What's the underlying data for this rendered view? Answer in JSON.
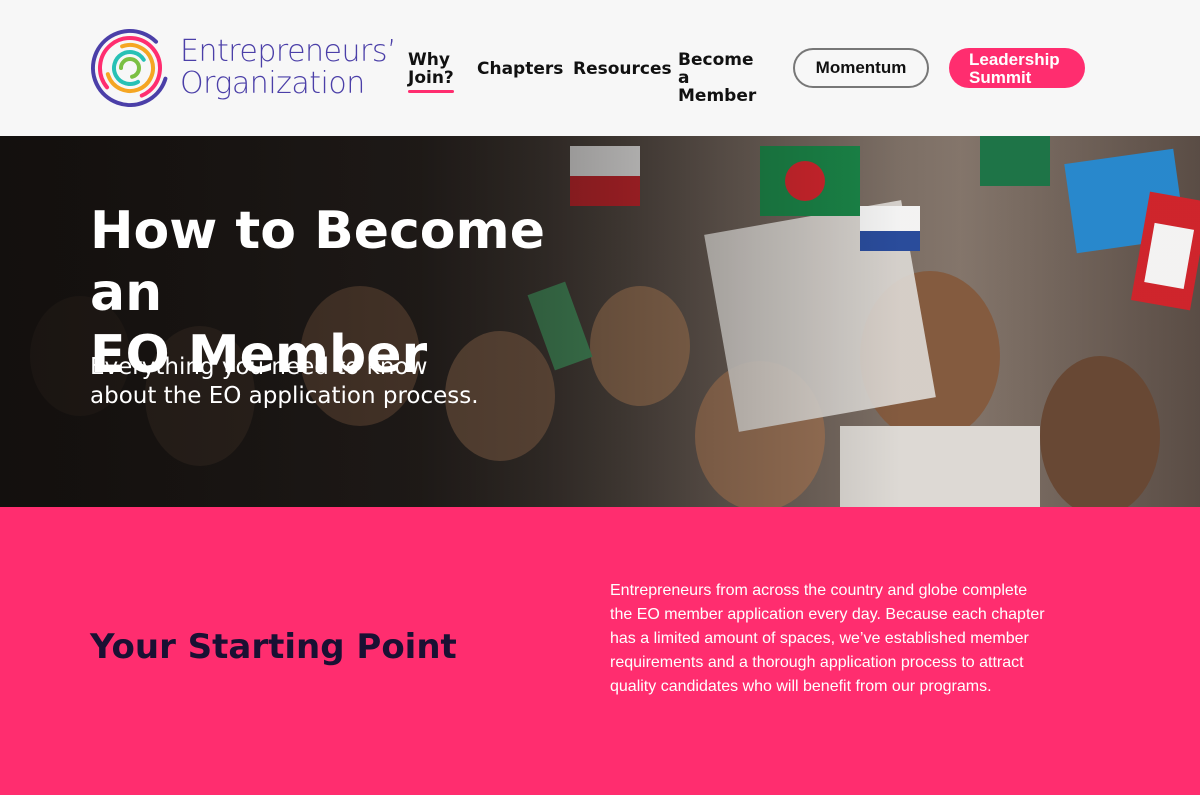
{
  "brand": {
    "name_line1": "Entrepreneurs’",
    "name_line2": "Organization",
    "primary_color": "#4b3fa8",
    "accent_color": "#ff2d6f"
  },
  "nav": {
    "items": [
      {
        "line1": "Why",
        "line2": "Join?",
        "active": true
      },
      {
        "line1": "Chapters",
        "line2": ""
      },
      {
        "line1": "Resources",
        "line2": ""
      },
      {
        "line1": "Become a",
        "line2": "Member"
      }
    ],
    "momentum_label": "Momentum",
    "summit_line1": "Leadership",
    "summit_line2": "Summit"
  },
  "hero": {
    "title_line1": "How to Become an",
    "title_line2": "EO Member",
    "subtitle_line1": "Everything you need to know",
    "subtitle_line2": "about the EO application process.",
    "image_icon": "crowd-with-flags-photo"
  },
  "intro": {
    "heading": "Your Starting Point",
    "body": "Entrepreneurs from across the country and globe complete the EO member application every day. Because each chapter has a limited amount of spaces, we’ve established member requirements and a thorough application process to attract quality candidates who will benefit from our programs.",
    "background_color": "#ff2d6f"
  }
}
